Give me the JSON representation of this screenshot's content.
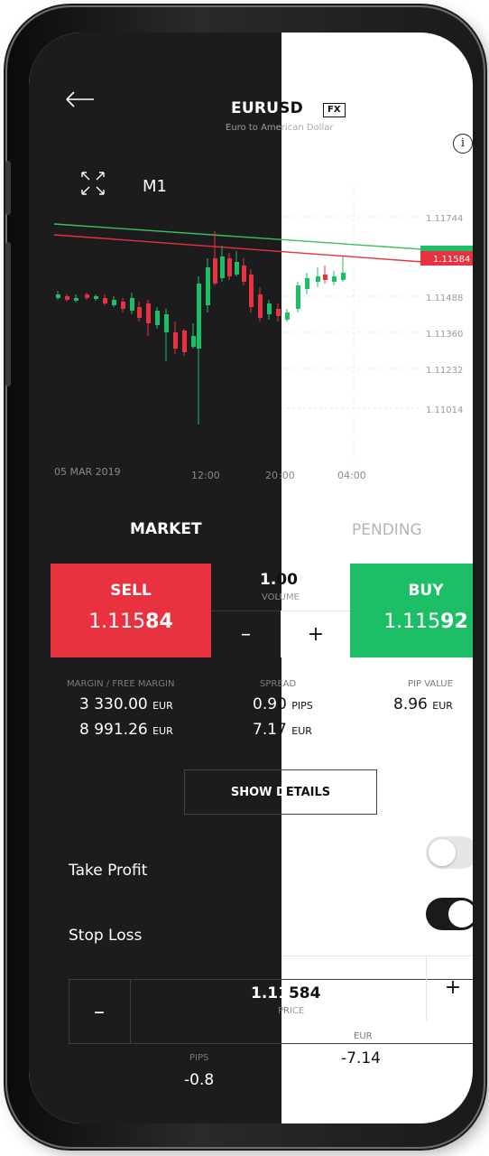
{
  "header": {
    "symbol_dark": "EURU",
    "symbol_light": "SD",
    "badge": "FX",
    "subtitle_dark": "Euro to Am",
    "subtitle_light": "erican Dollar",
    "info_icon": "i"
  },
  "chart_controls": {
    "timeframe": "M1"
  },
  "chart": {
    "price_levels": [
      "1.11744",
      "1.11584",
      "1.11488",
      "1.11360",
      "1.11232",
      "1.11014"
    ],
    "current_price": "1.11584",
    "time_labels": {
      "date": "05 MAR 2019",
      "t1": "12:00",
      "t2_dark": "20",
      "t2_light": ":00",
      "t3": "04:00"
    },
    "colors": {
      "up": "#1cbf66",
      "down": "#e8323f",
      "green_line": "#3cc05a",
      "red_line": "#e8323f"
    }
  },
  "tabs": {
    "market": "MARKET",
    "pending": "PENDING"
  },
  "trade": {
    "sell_label": "SELL",
    "sell_price_prefix": "1.115",
    "sell_price_bold": "84",
    "buy_label": "BUY",
    "buy_price_prefix": "1.115",
    "buy_price_bold": "92",
    "volume_dark": "1.",
    "volume_light": "00",
    "volume_label_dark": "VO",
    "volume_label_light": "LUME",
    "minus": "–",
    "plus": "+"
  },
  "stats": {
    "margin_label": "MARGIN / FREE MARGIN",
    "margin_value": "3 330.00",
    "margin_unit": "EUR",
    "free_margin_value": "8 991.26",
    "free_margin_unit": "EUR",
    "spread_label_dark": "SPR",
    "spread_label_light": "EAD",
    "spread_value_dark": "0.9",
    "spread_value_light": "0",
    "spread_unit": "PIPS",
    "spread_eur_dark": "7.1",
    "spread_eur_light": "7",
    "spread_eur_unit": "EUR",
    "pip_value_label": "PIP VALUE",
    "pip_value": "8.96",
    "pip_value_unit": "EUR"
  },
  "details": {
    "label_dark": "SHOW D",
    "label_light": "ETAILS"
  },
  "take_profit": {
    "label": "Take Profit",
    "enabled": false
  },
  "stop_loss": {
    "label": "Stop Loss",
    "enabled": true,
    "price_dark": "1.11",
    "price_light": "584",
    "price_label_dark": "PR",
    "price_label_light": "ICE",
    "minus": "–",
    "plus": "+",
    "pips_label": "PIPS",
    "pips_value": "-0.8",
    "eur_label": "EUR",
    "eur_value": "-7.14"
  }
}
